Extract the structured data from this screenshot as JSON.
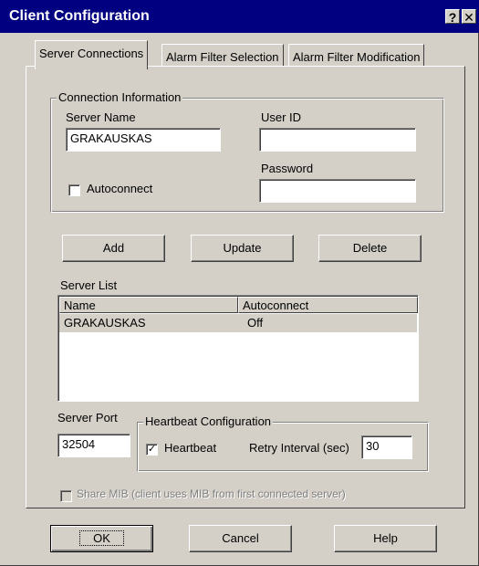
{
  "window": {
    "title": "Client Configuration",
    "help_glyph": "?",
    "close_glyph": "✕"
  },
  "tabs": [
    {
      "label": "Server Connections",
      "active": true
    },
    {
      "label": "Alarm Filter Selection",
      "active": false
    },
    {
      "label": "Alarm Filter Modification",
      "active": false
    }
  ],
  "connection": {
    "legend": "Connection Information",
    "server_name_label": "Server Name",
    "server_name_value": "GRAKAUSKAS",
    "user_id_label": "User ID",
    "user_id_value": "",
    "password_label": "Password",
    "password_value": "",
    "autoconnect_label": "Autoconnect",
    "autoconnect_checked": false
  },
  "actions": {
    "add_label": "Add",
    "update_label": "Update",
    "delete_label": "Delete"
  },
  "server_list": {
    "label": "Server List",
    "columns": [
      "Name",
      "Autoconnect"
    ],
    "rows": [
      {
        "name": "GRAKAUSKAS",
        "autoconnect": "Off",
        "selected": true
      }
    ]
  },
  "server_port": {
    "label": "Server Port",
    "value": "32504"
  },
  "heartbeat": {
    "legend": "Heartbeat Configuration",
    "heartbeat_label": "Heartbeat",
    "heartbeat_checked": true,
    "check_glyph": "✓",
    "retry_label": "Retry Interval (sec)",
    "retry_value": "30"
  },
  "share_mib": {
    "label": "Share MIB (client uses MIB from first connected server)",
    "enabled": false
  },
  "footer": {
    "ok_label": "OK",
    "cancel_label": "Cancel",
    "help_label": "Help"
  },
  "colors": {
    "titlebar": "#000080",
    "face": "#d4d0c8"
  }
}
